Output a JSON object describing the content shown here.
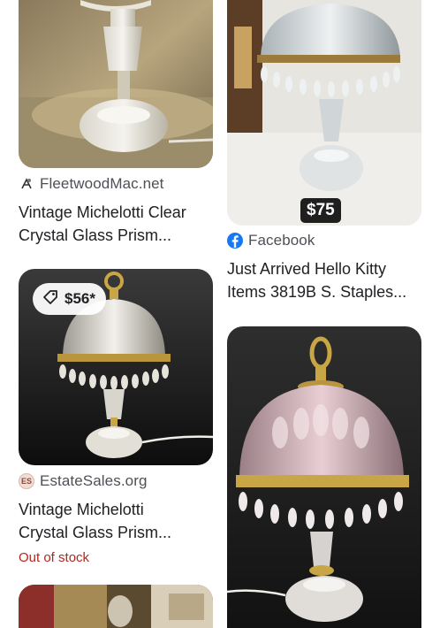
{
  "left": {
    "card1": {
      "source": "FleetwoodMac.net",
      "title_line1": "Vintage Michelotti Clear",
      "title_line2": "Crystal Glass Prism..."
    },
    "card2": {
      "price": "$56*",
      "source": "EstateSales.org",
      "source_icon_text": "ES",
      "title_line1": "Vintage Michelotti",
      "title_line2": "Crystal Glass Prism...",
      "stock": "Out of stock"
    }
  },
  "right": {
    "card1": {
      "price": "$75",
      "source": "Facebook",
      "title_line1": "Just Arrived Hello Kitty",
      "title_line2": "Items 3819B S. Staples..."
    }
  },
  "colors": {
    "stock_red": "#b3261e",
    "facebook_blue": "#1877f2",
    "text_primary": "#202124",
    "text_secondary": "#4d5156"
  }
}
